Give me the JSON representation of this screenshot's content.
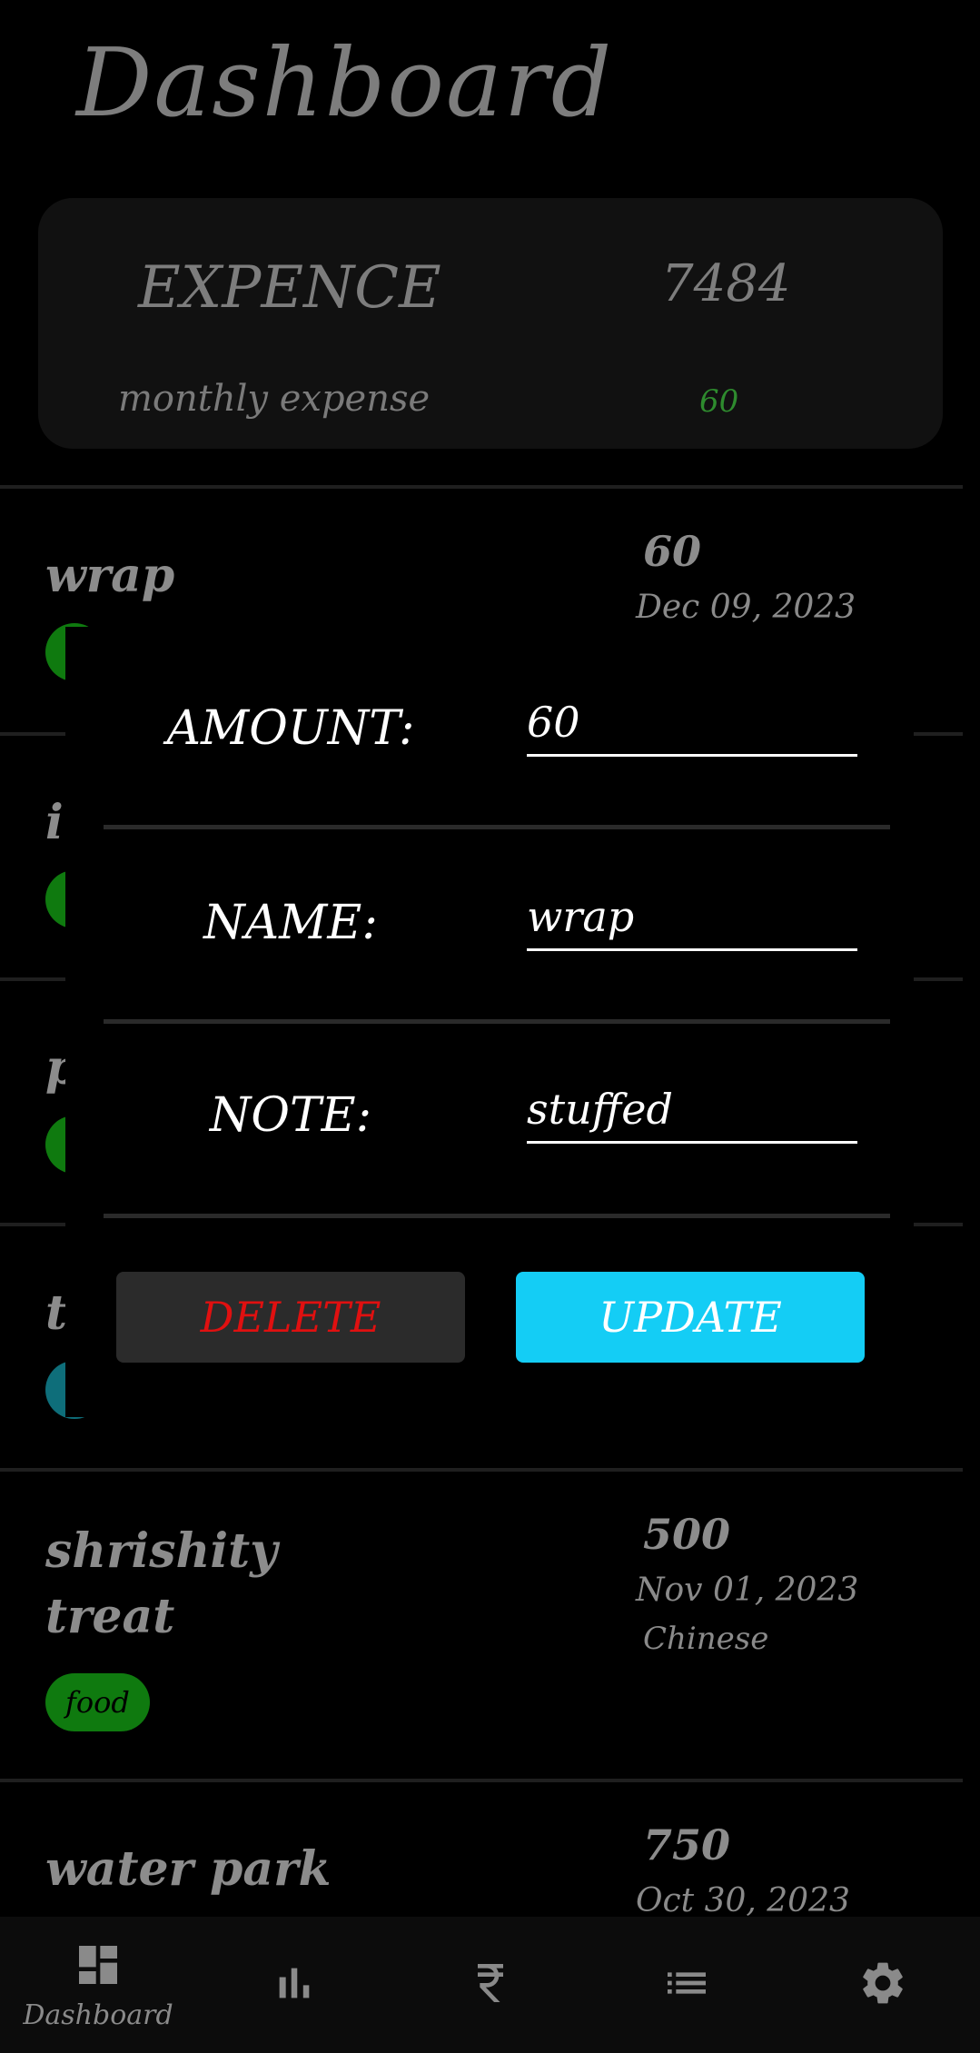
{
  "header": {
    "title": "Dashboard"
  },
  "summary": {
    "label": "EXPENCE",
    "total": "7484",
    "sub_label": "monthly expense",
    "sub_value": "60",
    "sub_value_color": "#2e8b2e"
  },
  "items": [
    {
      "name": "wrap",
      "amount": "60",
      "date": "Dec 09, 2023"
    },
    {
      "name": "i",
      "tag_color": "#0f7a0f"
    },
    {
      "name": "p",
      "tag_color": "#0f7a0f"
    },
    {
      "name": "t",
      "tag_color": "#0e6e7a"
    },
    {
      "name": "shrishity treat",
      "name_line1": "shrishity",
      "name_line2": "treat",
      "amount": "500",
      "date": "Nov 01, 2023",
      "note": "Chinese",
      "tag": "food"
    },
    {
      "name": "water park",
      "amount": "750",
      "date": "Oct 30, 2023"
    }
  ],
  "dialog": {
    "amount_label": "AMOUNT:",
    "amount_value": "60",
    "name_label": "NAME:",
    "name_value": "wrap",
    "note_label": "NOTE:",
    "note_value": "stuffed",
    "delete_label": "DELETE",
    "update_label": "UPDATE",
    "delete_color": "#e01010",
    "update_color": "#14cdf5"
  },
  "nav": {
    "items": [
      {
        "label": "Dashboard",
        "icon": "dashboard-icon"
      },
      {
        "label": "",
        "icon": "bar-chart-icon"
      },
      {
        "label": "",
        "icon": "rupee-icon"
      },
      {
        "label": "",
        "icon": "list-icon"
      },
      {
        "label": "",
        "icon": "gear-icon"
      }
    ]
  }
}
